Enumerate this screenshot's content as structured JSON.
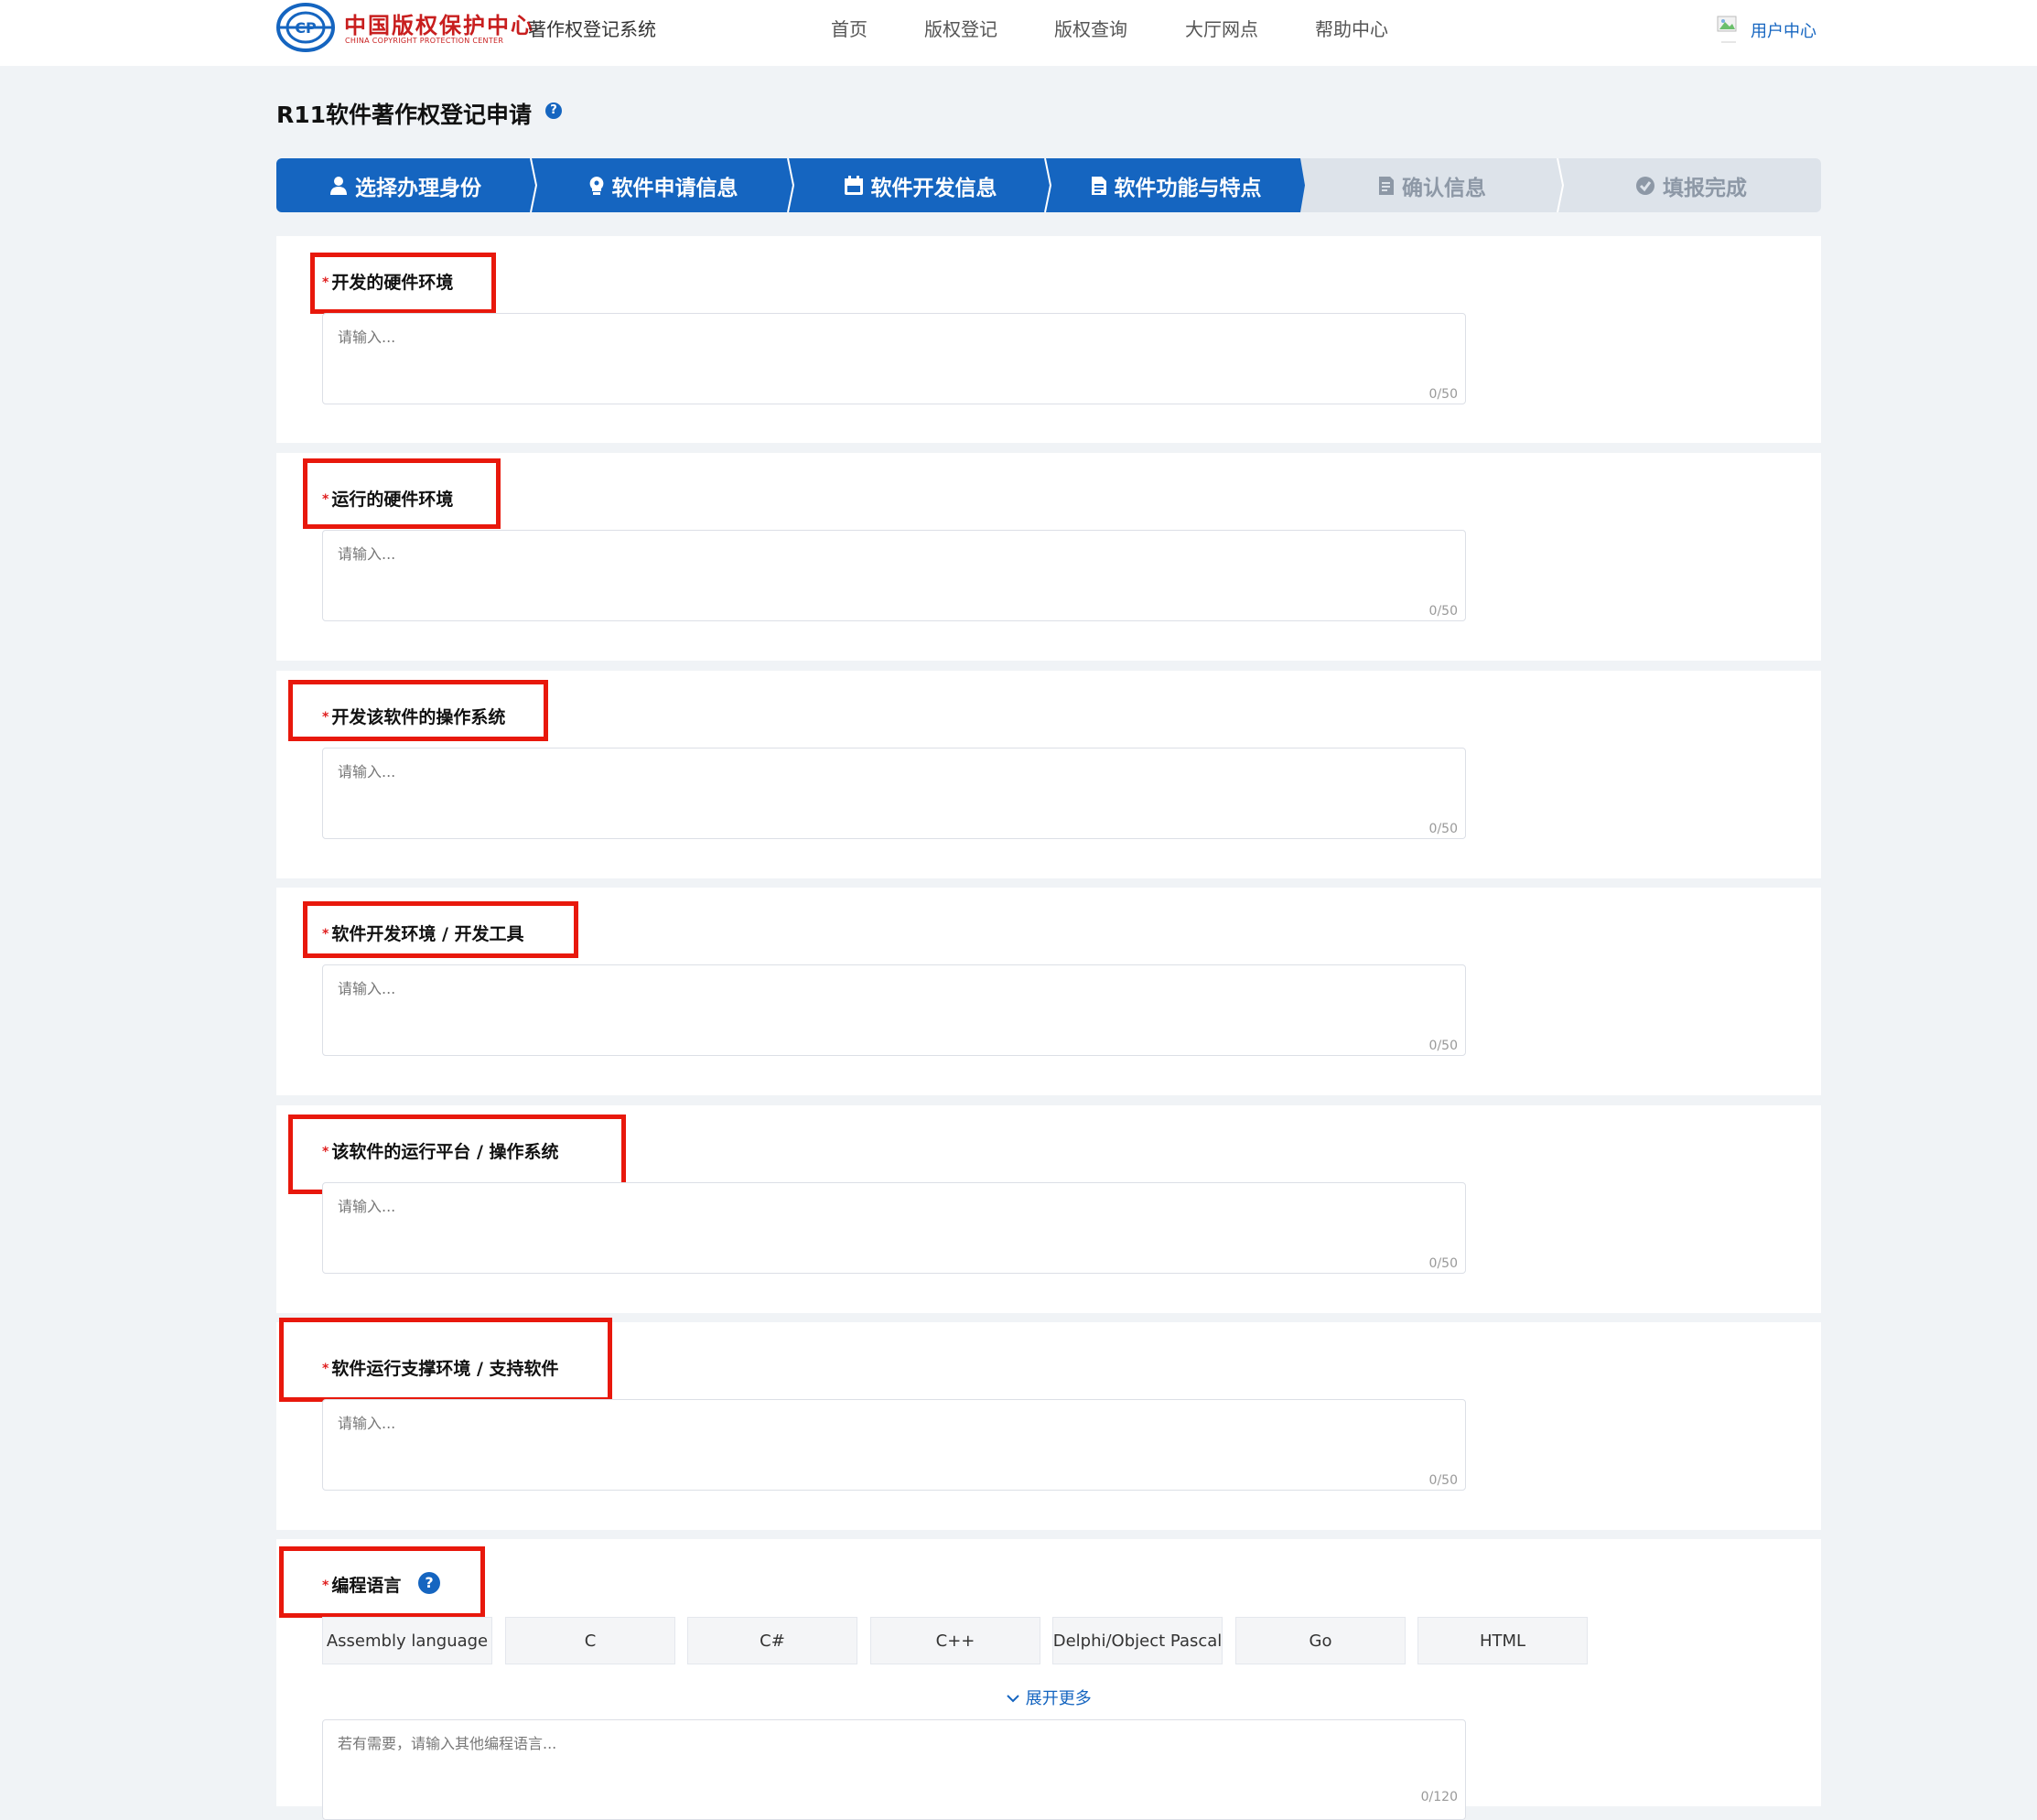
{
  "header": {
    "logo_cn": "中国版权保护中心",
    "logo_en": "CHINA COPYRIGHT PROTECTION CENTER",
    "system_name": "著作权登记系统",
    "nav": [
      "首页",
      "版权登记",
      "版权查询",
      "大厅网点",
      "帮助中心"
    ],
    "user_center": "用户中心",
    "icons": {
      "logo": "cpc-logo-icon",
      "avatar": "user-avatar-icon"
    }
  },
  "page": {
    "title": "R11软件著作权登记申请",
    "help_mark": "?"
  },
  "steps": [
    {
      "label": "选择办理身份",
      "state": "done",
      "icon": "user-icon"
    },
    {
      "label": "软件申请信息",
      "state": "done",
      "icon": "bulb-icon"
    },
    {
      "label": "软件开发信息",
      "state": "done",
      "icon": "calendar-icon"
    },
    {
      "label": "软件功能与特点",
      "state": "current",
      "icon": "document-icon"
    },
    {
      "label": "确认信息",
      "state": "pending",
      "icon": "confirm-icon"
    },
    {
      "label": "填报完成",
      "state": "pending",
      "icon": "check-circle-icon"
    }
  ],
  "form": {
    "required_mark": "*",
    "placeholder": "请输入...",
    "fields": [
      {
        "label": "开发的硬件环境",
        "value": "",
        "counter": "0/50"
      },
      {
        "label": "运行的硬件环境",
        "value": "",
        "counter": "0/50"
      },
      {
        "label": "开发该软件的操作系统",
        "value": "",
        "counter": "0/50"
      },
      {
        "label": "软件开发环境 / 开发工具",
        "value": "",
        "counter": "0/50"
      },
      {
        "label": "该软件的运行平台 / 操作系统",
        "value": "",
        "counter": "0/50"
      },
      {
        "label": "软件运行支撑环境 / 支持软件",
        "value": "",
        "counter": "0/50"
      }
    ],
    "language": {
      "label": "编程语言",
      "help_mark": "?",
      "options": [
        "Assembly language",
        "C",
        "C#",
        "C++",
        "Delphi/Object Pascal",
        "Go",
        "HTML"
      ],
      "expand_more": "展开更多",
      "other_placeholder": "若有需要，请输入其他编程语言...",
      "other_counter": "0/120"
    }
  },
  "colors": {
    "primary": "#1565c0",
    "highlight": "#e8180c",
    "required": "#e02020",
    "step_pending_bg": "#dde3ea",
    "page_bg": "#f0f3f6"
  }
}
